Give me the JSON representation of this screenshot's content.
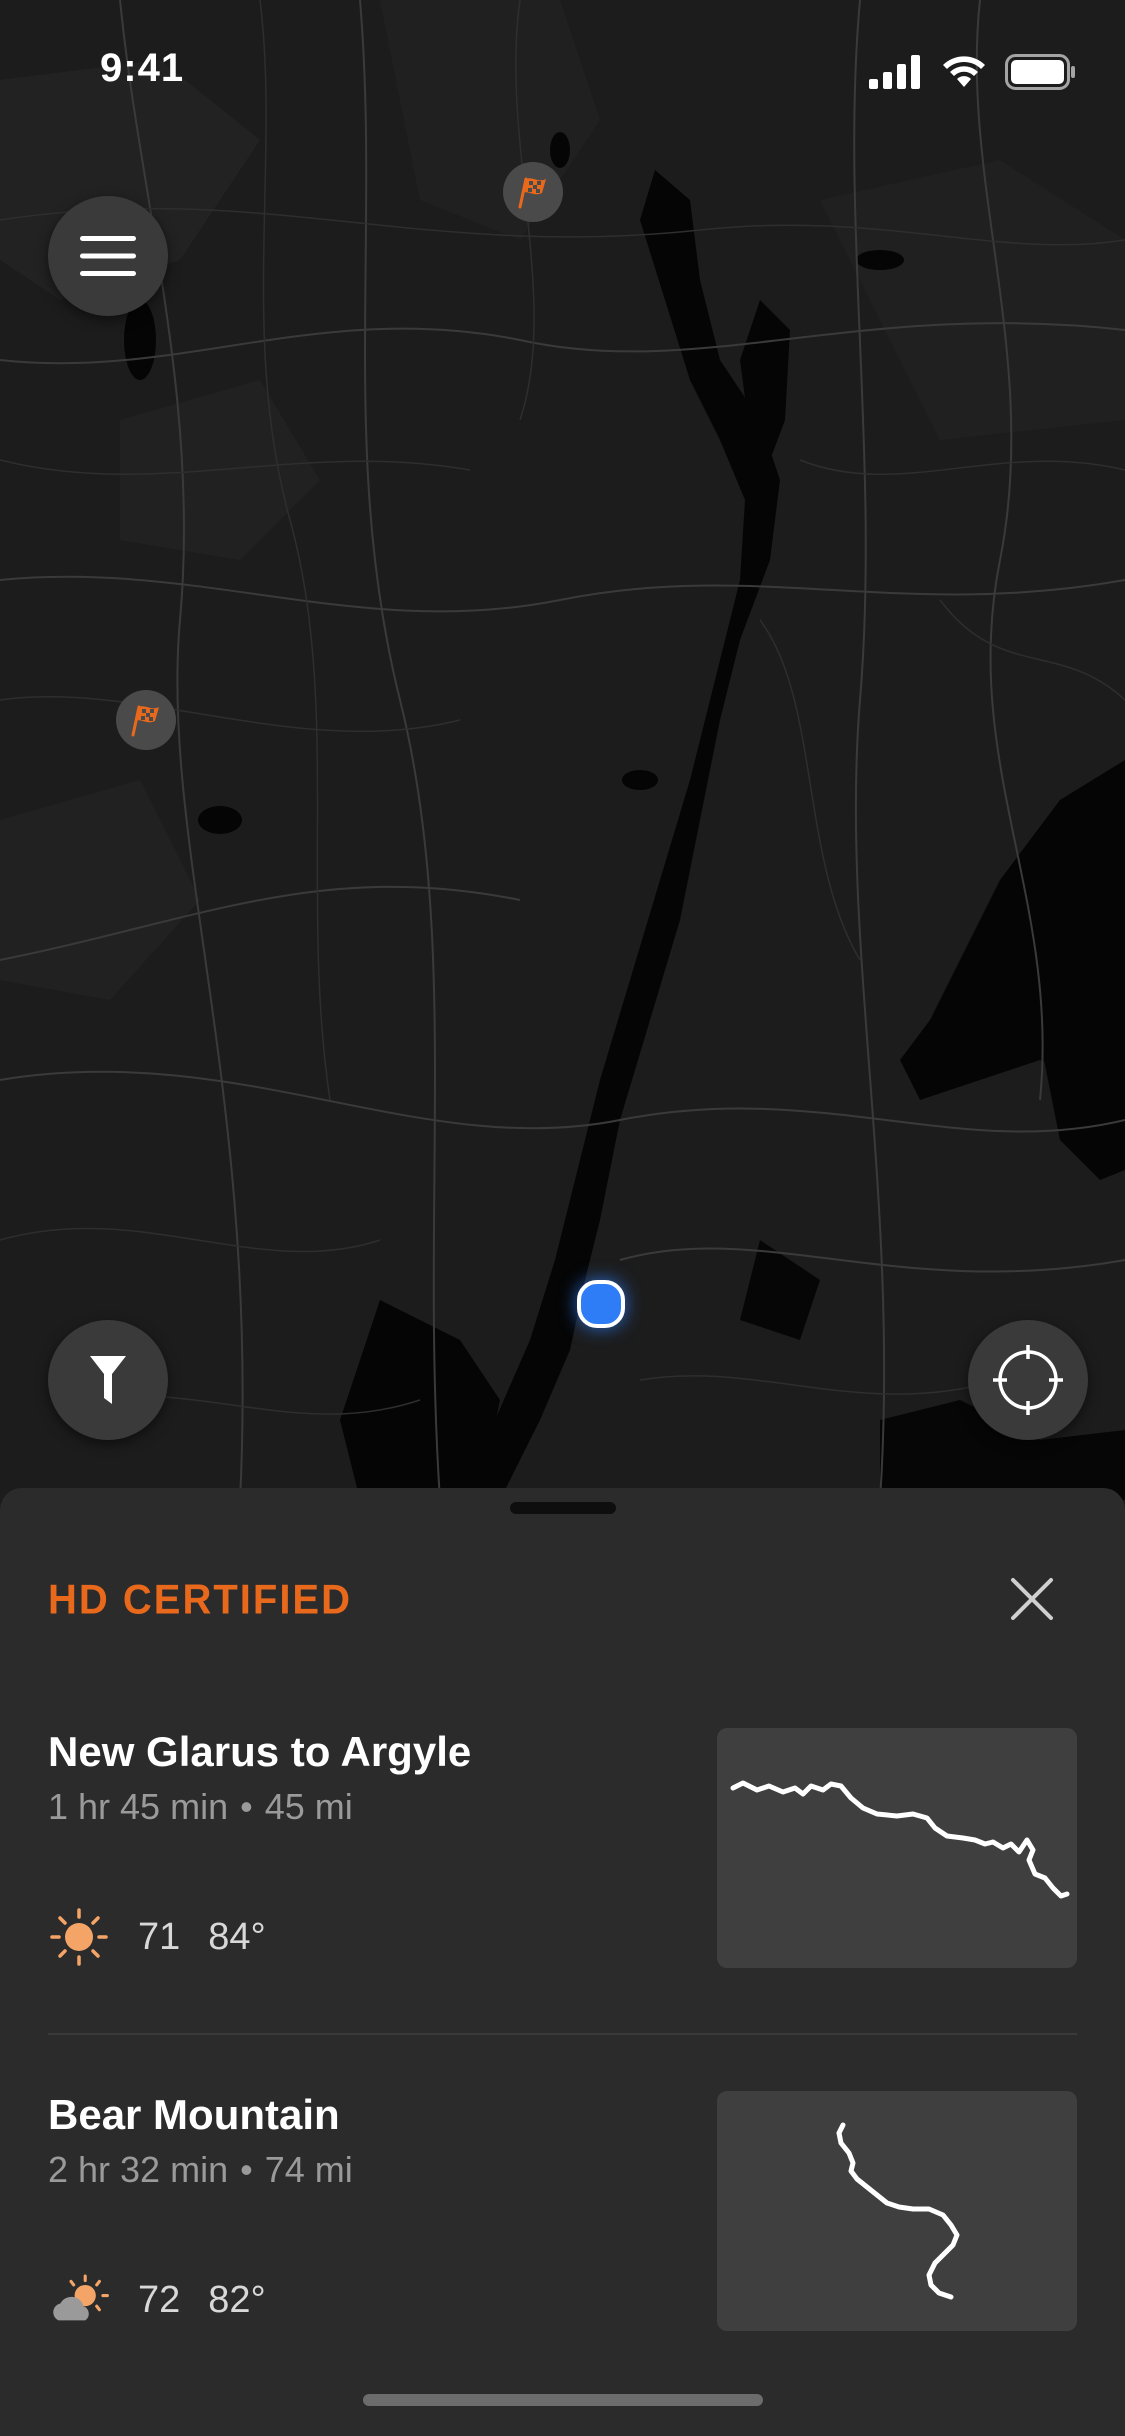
{
  "status_bar": {
    "time": "9:41"
  },
  "map": {
    "land_color": "#1c1c1c",
    "water_color": "#050505",
    "road_color": "#3a3a3a",
    "accent_flag_color": "#e8681c",
    "location_dot_color": "#2f7df6"
  },
  "controls": {
    "menu_icon": "hamburger-icon",
    "filter_icon": "filter-icon",
    "locate_icon": "crosshair-icon"
  },
  "sheet": {
    "title": "HD CERTIFIED",
    "title_color": "#e8681c",
    "routes": [
      {
        "name": "New Glarus to Argyle",
        "duration": "1 hr 45 min",
        "distance": "45 mi",
        "weather_icon": "sun-icon",
        "temp_low": "71",
        "temp_high": "84°"
      },
      {
        "name": "Bear Mountain",
        "duration": "2 hr 32 min",
        "distance": "74 mi",
        "weather_icon": "partly-cloudy-icon",
        "temp_low": "72",
        "temp_high": "82°"
      }
    ]
  }
}
